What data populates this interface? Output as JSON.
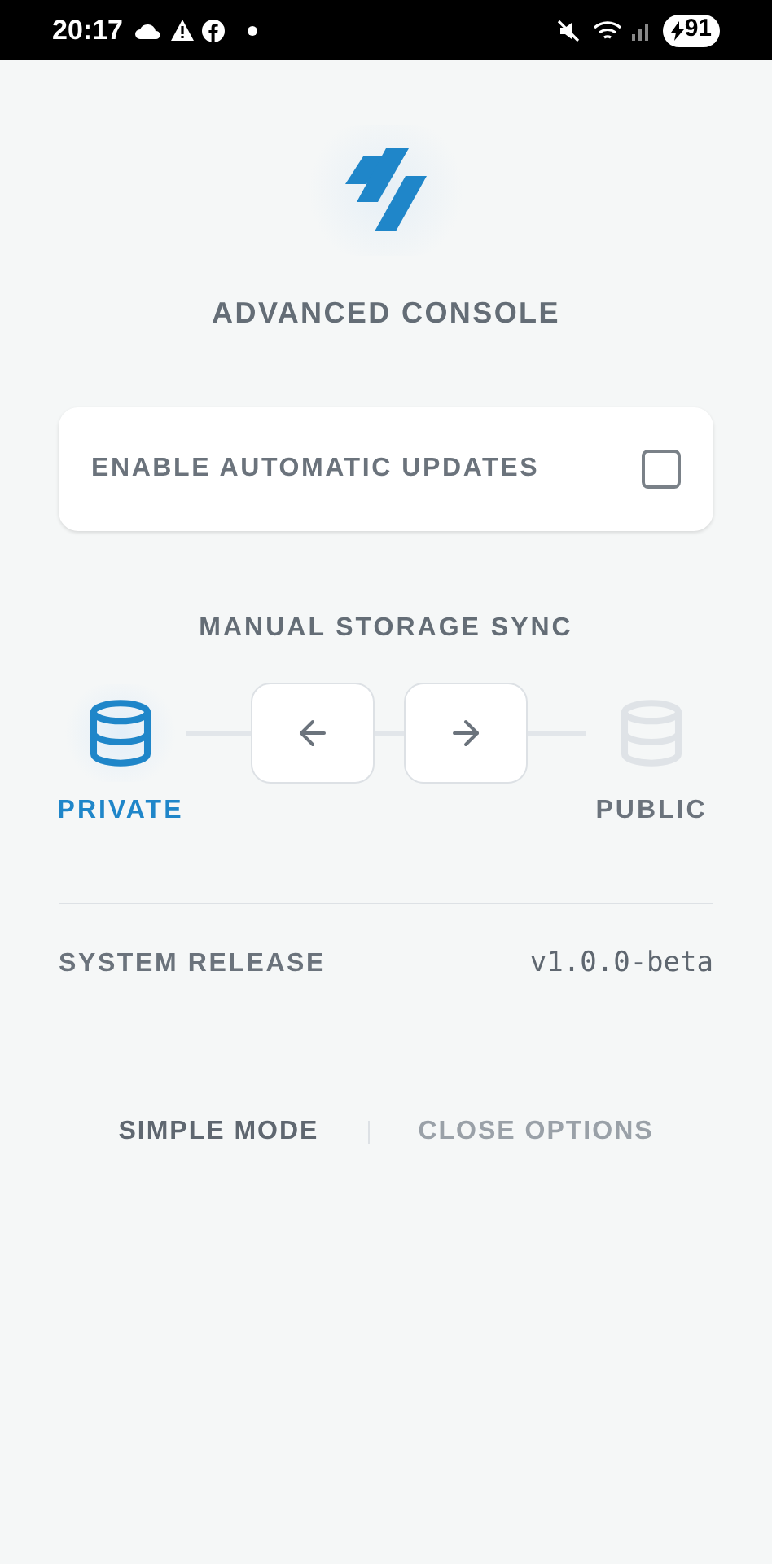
{
  "status_bar": {
    "time": "20:17",
    "battery": "91"
  },
  "header": {
    "title": "ADVANCED CONSOLE"
  },
  "settings": {
    "label": "ENABLE AUTOMATIC UPDATES",
    "checked": false
  },
  "sync": {
    "title": "MANUAL STORAGE SYNC",
    "endpoints": [
      {
        "label": "PRIVATE",
        "selected": true
      },
      {
        "label": "PUBLIC",
        "selected": false
      }
    ]
  },
  "release": {
    "label": "SYSTEM RELEASE",
    "value": "v1.0.0-beta"
  },
  "footer": {
    "links": [
      {
        "label": "SIMPLE MODE",
        "kind": "primary"
      },
      {
        "label": "CLOSE OPTIONS",
        "kind": "secondary"
      }
    ]
  }
}
